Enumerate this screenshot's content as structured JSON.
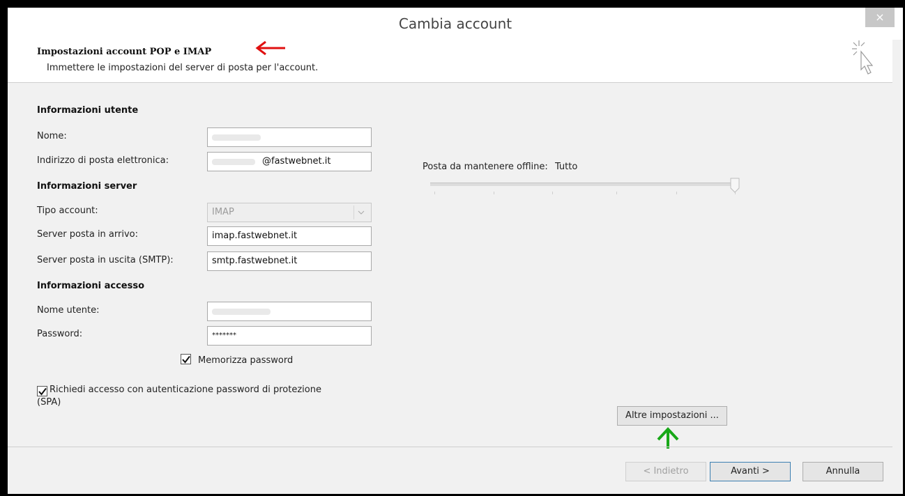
{
  "window": {
    "title": "Cambia account",
    "close_glyph": "×"
  },
  "header": {
    "title": "Impostazioni account POP e IMAP",
    "subtitle": "Immettere le impostazioni del server di posta per l'account.",
    "annotation_arrow_color": "#e01010",
    "icon": "wizard-cursor-icon"
  },
  "user_info": {
    "heading": "Informazioni utente",
    "name_label": "Nome:",
    "name_value": "",
    "email_label": "Indirizzo di posta elettronica:",
    "email_value": "@fastwebnet.it"
  },
  "server_info": {
    "heading": "Informazioni server",
    "account_type_label": "Tipo account:",
    "account_type_value": "IMAP",
    "incoming_label": "Server posta in arrivo:",
    "incoming_value": "imap.fastwebnet.it",
    "outgoing_label": "Server posta in uscita (SMTP):",
    "outgoing_value": "smtp.fastwebnet.it"
  },
  "login_info": {
    "heading": "Informazioni accesso",
    "username_label": "Nome utente:",
    "username_value": "",
    "password_label": "Password:",
    "password_value": "*******",
    "remember_label": "Memorizza password",
    "remember_checked": true,
    "spa_label_line1": "Richiedi accesso con autenticazione password di protezione",
    "spa_label_line2": "(SPA)",
    "spa_checked": true
  },
  "offline": {
    "label": "Posta da mantenere offline:",
    "value": "Tutto",
    "slider_level": 1.0
  },
  "buttons": {
    "more_settings": "Altre impostazioni ...",
    "back": "< Indietro",
    "next": "Avanti >",
    "cancel": "Annulla"
  },
  "colors": {
    "annotation_green": "#18a818",
    "annotation_red": "#e01010",
    "primary_button_border": "#3c7fb1"
  }
}
